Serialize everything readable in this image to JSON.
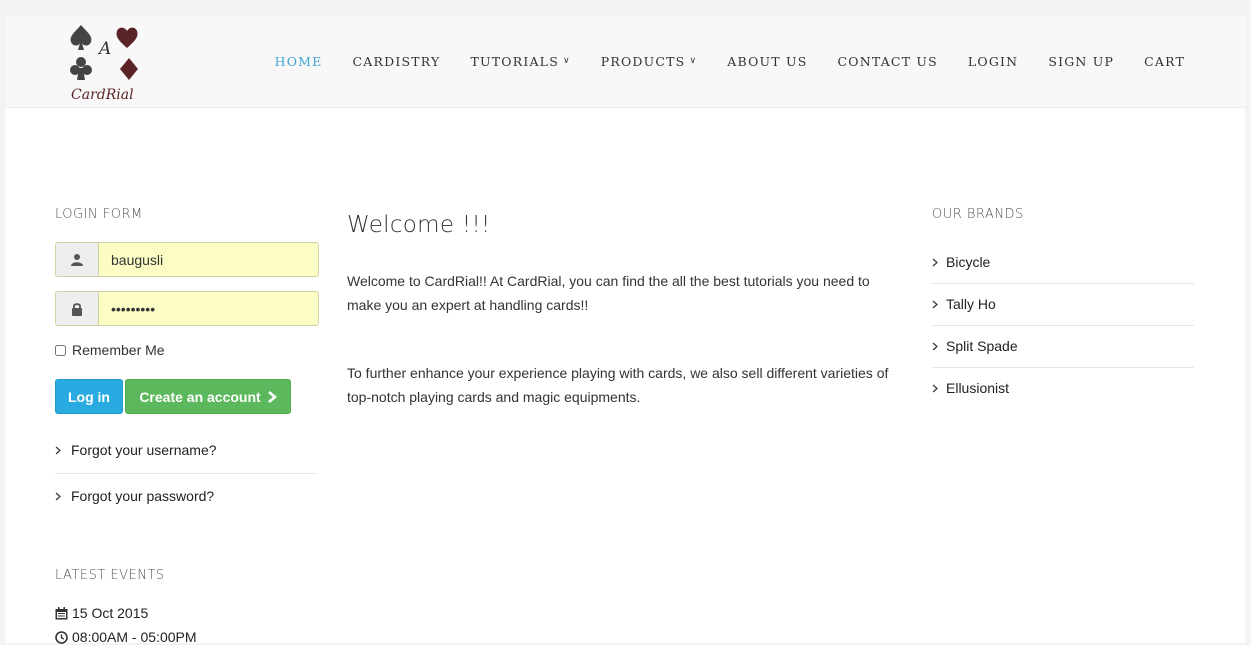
{
  "logo": {
    "alt": "CardRial",
    "letter": "A",
    "wordmark": "CardRial"
  },
  "nav": {
    "items": [
      {
        "label": "HOME",
        "active": true,
        "dropdown": false
      },
      {
        "label": "CARDISTRY",
        "active": false,
        "dropdown": false
      },
      {
        "label": "TUTORIALS",
        "active": false,
        "dropdown": true
      },
      {
        "label": "PRODUCTS",
        "active": false,
        "dropdown": true
      },
      {
        "label": "ABOUT US",
        "active": false,
        "dropdown": false
      },
      {
        "label": "CONTACT US",
        "active": false,
        "dropdown": false
      },
      {
        "label": "LOGIN",
        "active": false,
        "dropdown": false
      },
      {
        "label": "SIGN UP",
        "active": false,
        "dropdown": false
      },
      {
        "label": "CART",
        "active": false,
        "dropdown": false
      }
    ]
  },
  "login": {
    "title": "LOGIN FORM",
    "username_value": "baugusli",
    "password_value": "•••••••••",
    "remember_label": "Remember Me",
    "login_button": "Log in",
    "create_button": "Create an account",
    "forgot_username": "Forgot your username?",
    "forgot_password": "Forgot your password?"
  },
  "events": {
    "title": "LATEST EVENTS",
    "date": "15 Oct 2015",
    "time": "08:00AM - 05:00PM"
  },
  "main": {
    "title": "Welcome !!!",
    "paragraph1": "Welcome to CardRial!! At CardRial, you can find the all the best tutorials you need to make you an expert at handling cards!!",
    "paragraph2": "To further enhance your experience playing with cards, we also sell different varieties of top-notch playing cards and magic equipments."
  },
  "brands": {
    "title": "OUR BRANDS",
    "items": [
      "Bicycle",
      "Tally Ho",
      "Split Spade",
      "Ellusionist"
    ]
  },
  "colors": {
    "accent": "#29abe2",
    "nav_active": "#3fa7d6",
    "success": "#5cb85c",
    "autofill": "#fbfdc5"
  },
  "icons": {
    "user": "user-icon",
    "lock": "lock-icon",
    "chevron": "chevron-right-icon",
    "calendar": "calendar-icon",
    "clock": "clock-icon"
  }
}
